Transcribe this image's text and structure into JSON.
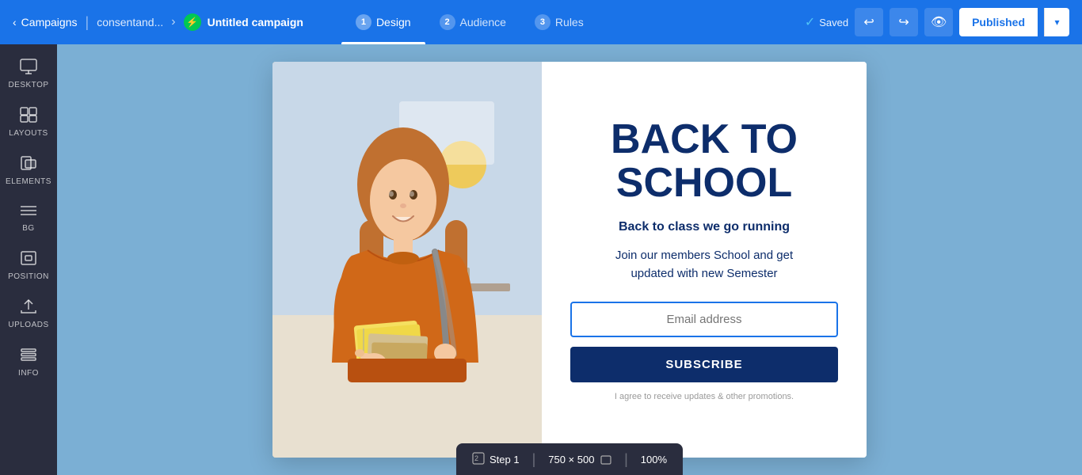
{
  "topNav": {
    "backLabel": "Campaigns",
    "breadcrumb": "consentand...",
    "campaignIcon": "⚡",
    "campaignName": "Untitled campaign",
    "tabs": [
      {
        "num": "1",
        "label": "Design",
        "active": true
      },
      {
        "num": "2",
        "label": "Audience",
        "active": false
      },
      {
        "num": "3",
        "label": "Rules",
        "active": false
      }
    ],
    "savedLabel": "Saved",
    "publishLabel": "Published",
    "dropdownArrow": "▾"
  },
  "sidebar": {
    "items": [
      {
        "id": "desktop",
        "icon": "🖥",
        "label": "DESKTOP"
      },
      {
        "id": "layouts",
        "icon": "⊞",
        "label": "LAYOUTS"
      },
      {
        "id": "elements",
        "icon": "◱",
        "label": "ELEMENTS"
      },
      {
        "id": "bg",
        "icon": "≡",
        "label": "BG"
      },
      {
        "id": "position",
        "icon": "⊡",
        "label": "POSITION"
      },
      {
        "id": "uploads",
        "icon": "↑",
        "label": "UPLOADS"
      },
      {
        "id": "info",
        "icon": "⌨",
        "label": "INFO"
      }
    ]
  },
  "popup": {
    "title": "BACK TO\nSCHOOL",
    "titleLine1": "BACK TO",
    "titleLine2": "SCHOOL",
    "subtitle": "Back to class we go running",
    "description": "Join our members School and get\nupdated with new Semester",
    "emailPlaceholder": "Email address",
    "subscribeLabel": "SUBSCRIBE",
    "agreeText": "I agree to receive updates & other promotions."
  },
  "bottomBar": {
    "stepLabel": "Step 1",
    "dimensions": "750 × 500",
    "zoom": "100%"
  },
  "colors": {
    "navBg": "#1a73e8",
    "sidebarBg": "#2a2d3e",
    "canvasBg": "#7bafd4",
    "popupTitleColor": "#0d2d6b",
    "subscribeBtnBg": "#0d2d6b"
  }
}
